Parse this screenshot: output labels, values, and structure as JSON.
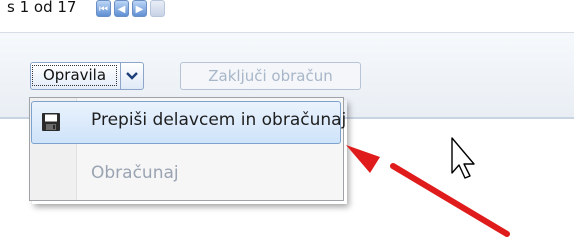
{
  "pager": {
    "text": "s 1 od 17",
    "buttons": [
      {
        "icon": "first-page-icon"
      },
      {
        "icon": "previous-page-icon"
      },
      {
        "icon": "next-page-icon"
      },
      {
        "icon": "last-page-icon"
      }
    ]
  },
  "toolbar": {
    "menu_button_label": "Opravila",
    "dropdown_icon": "chevron-down-icon",
    "disabled_button_label": "Zaključi obračun"
  },
  "dropdown_menu": {
    "items": [
      {
        "label": "Prepiši delavcem in obračunaj",
        "icon": "save-icon",
        "enabled": true,
        "highlighted": true
      },
      {
        "label": "Obračunaj",
        "enabled": false,
        "highlighted": false
      }
    ]
  },
  "annotation": {
    "icon": "red-arrow-icon",
    "color": "#e01b1b"
  },
  "cursor": {
    "icon": "mouse-pointer-icon"
  }
}
